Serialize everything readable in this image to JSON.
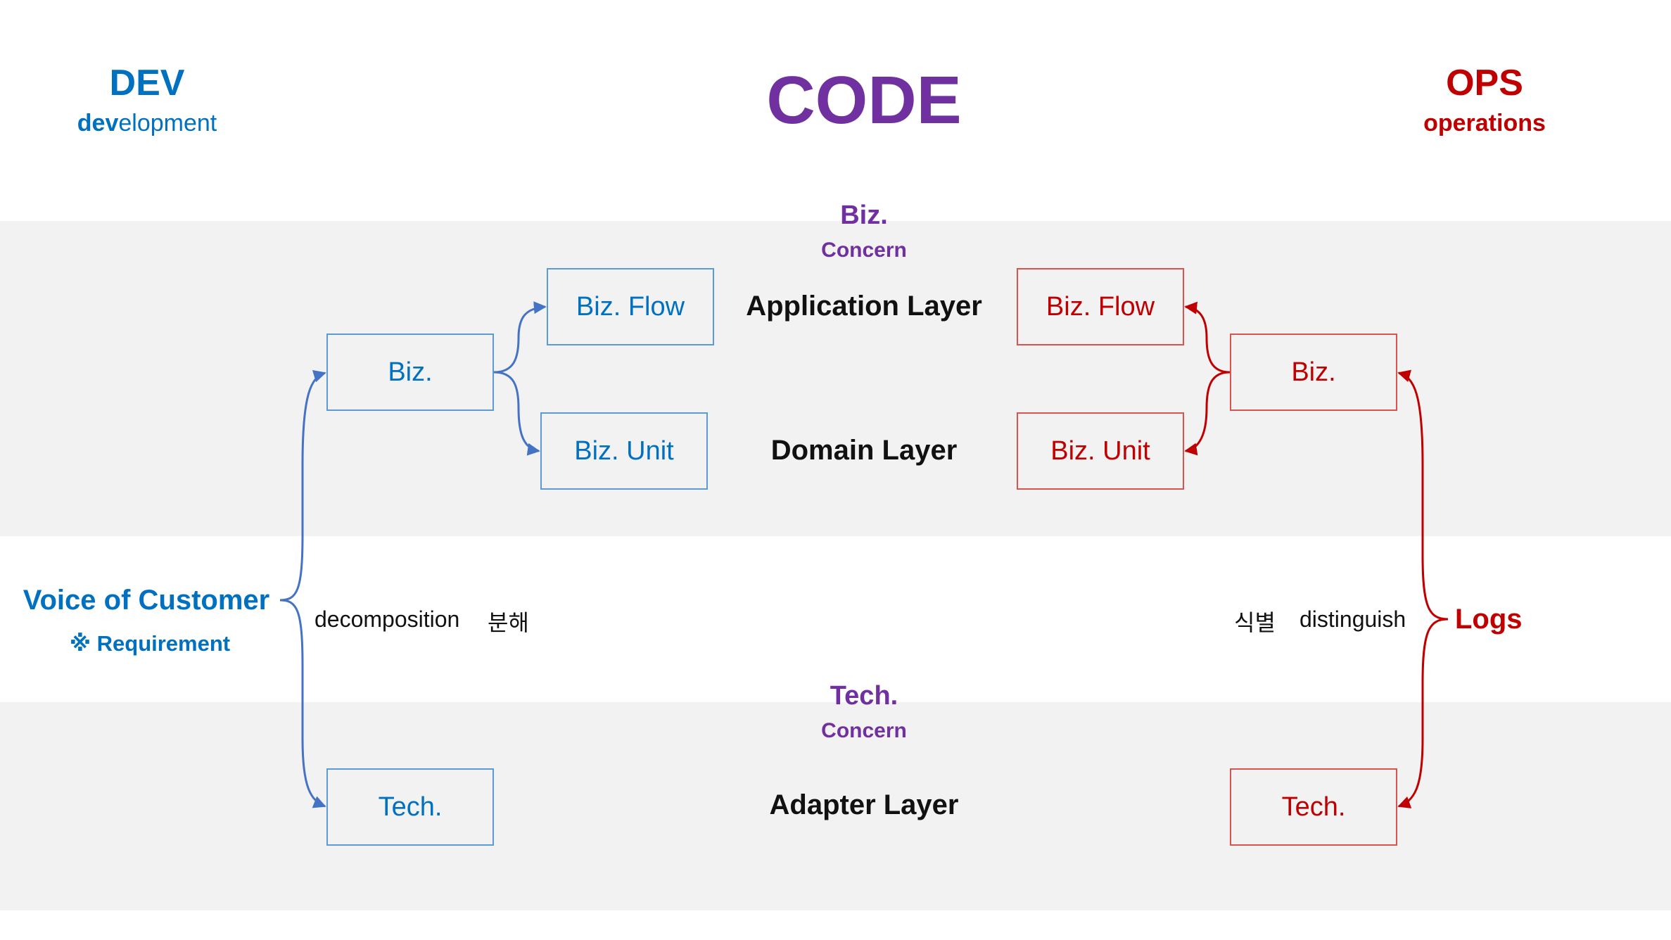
{
  "header": {
    "dev_title": "DEV",
    "dev_sub_bold": "dev",
    "dev_sub_rest": "elopment",
    "code_title": "CODE",
    "ops_title": "OPS",
    "ops_sub": "operations"
  },
  "concerns": {
    "biz_title": "Biz.",
    "biz_sub": "Concern",
    "tech_title": "Tech.",
    "tech_sub": "Concern"
  },
  "layers": {
    "application": "Application Layer",
    "domain": "Domain Layer",
    "adapter": "Adapter Layer"
  },
  "dev_boxes": {
    "biz": "Biz.",
    "biz_flow": "Biz. Flow",
    "biz_unit": "Biz. Unit",
    "tech": "Tech."
  },
  "ops_boxes": {
    "biz": "Biz.",
    "biz_flow": "Biz. Flow",
    "biz_unit": "Biz. Unit",
    "tech": "Tech."
  },
  "left": {
    "voc": "Voice of Customer",
    "requirement": "※ Requirement",
    "decomposition": "decomposition",
    "decomposition_ko": "분해"
  },
  "right": {
    "logs": "Logs",
    "distinguish_ko": "식별",
    "distinguish": "distinguish"
  },
  "colors": {
    "dev_blue": "#0070c0",
    "dev_line": "#4472c4",
    "ops_red": "#c00000",
    "code_purple": "#7030a0",
    "band_gray": "#f2f2f2"
  }
}
